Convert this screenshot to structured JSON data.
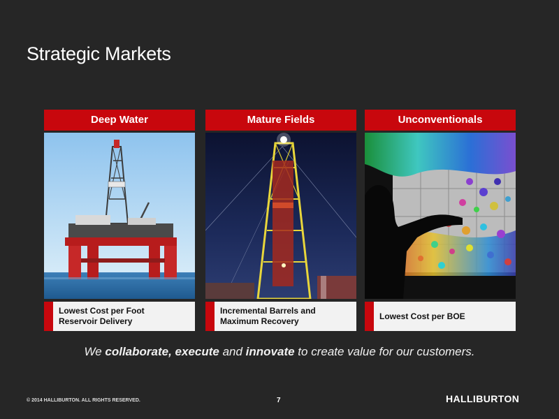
{
  "slide": {
    "title": "Strategic Markets",
    "tagline": {
      "p1": "We ",
      "b1": "collaborate, execute",
      "p2": " and ",
      "b2": "innovate",
      "p3": " to create value for our customers."
    },
    "footer": {
      "copyright": "© 2014 HALLIBURTON. ALL RIGHTS RESERVED.",
      "page_number": "7",
      "logo": "HALLIBURTON"
    }
  },
  "cards": [
    {
      "header": "Deep Water",
      "caption": "Lowest Cost per Foot\nReservoir Delivery",
      "image": "offshore-rig-photo"
    },
    {
      "header": "Mature Fields",
      "caption": "Incremental Barrels and\nMaximum Recovery",
      "image": "land-rig-night-photo"
    },
    {
      "header": "Unconventionals",
      "caption": "Lowest Cost per BOE",
      "image": "reservoir-visualization-photo"
    }
  ],
  "colors": {
    "background": "#262626",
    "accent_red": "#c8070d",
    "caption_bg": "#f2f2f2"
  }
}
